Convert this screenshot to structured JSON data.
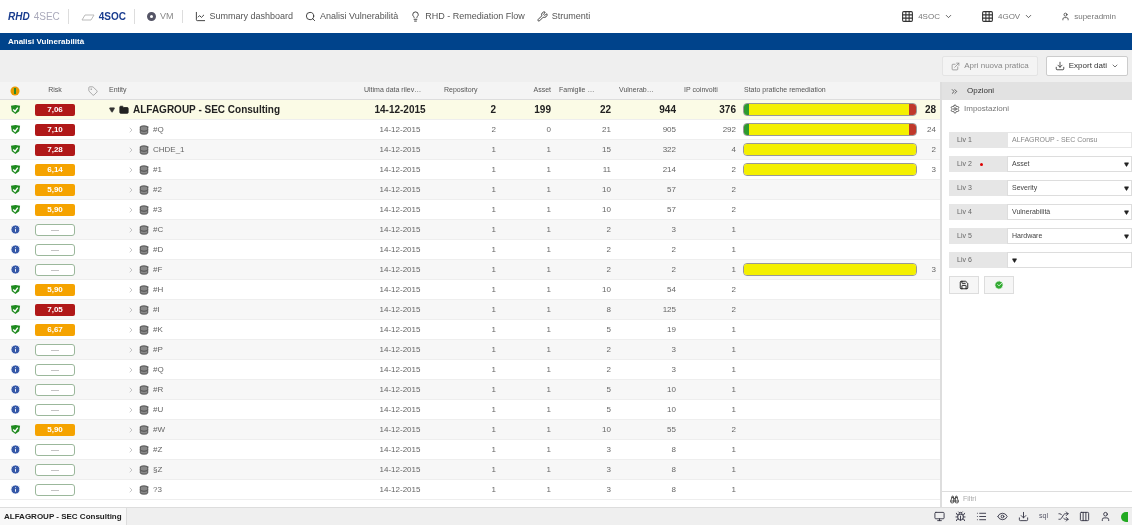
{
  "brand": {
    "logo": "RHD",
    "product": "4SEC",
    "modules": [
      {
        "kind": "soc",
        "label": "4SOC"
      },
      {
        "kind": "vm",
        "label": "VM"
      }
    ]
  },
  "nav": [
    {
      "kind": "chart",
      "label": "Summary dashboard"
    },
    {
      "kind": "search",
      "label": "Analisi Vulnerabilità"
    },
    {
      "kind": "bulb",
      "label": "RHD - Remediation Flow"
    },
    {
      "kind": "tools",
      "label": "Strumenti"
    }
  ],
  "nav_right": [
    {
      "kind": "grid",
      "label": "4SOC"
    },
    {
      "kind": "grid",
      "label": "4GOV"
    },
    {
      "kind": "user",
      "label": "superadmin"
    }
  ],
  "page_title": "Analisi Vulnerabilità",
  "toolbar": [
    {
      "kind": "new",
      "label": "Apri nuova pratica",
      "disabled": true
    },
    {
      "kind": "export",
      "label": "Export dati",
      "disabled": false
    }
  ],
  "table": {
    "columns": [
      "Risk",
      "Entity",
      "Ultima data rilev…",
      "Repository",
      "Asset",
      "Famiglie …",
      "Vulnerab…",
      "IP coinvolti",
      "Stato pratiche remediation"
    ],
    "rows": [
      {
        "selected": true,
        "status": {
          "kind": "ok"
        },
        "risk": {
          "kind": "score",
          "text": "7,06",
          "color": "#b01818"
        },
        "expanded": true,
        "kind": "group",
        "entity": "ALFAGROUP - SEC Consulting",
        "date": "14-12-2015",
        "repository": "2",
        "asset": "199",
        "famiglie": "22",
        "vulnerab": "944",
        "ip": "376",
        "remediation": [
          {
            "color": "#2f9a2f",
            "level": 0.03
          },
          {
            "color": "#f4f000",
            "level": 0.93
          },
          {
            "color": "#c0392b",
            "level": 0.04
          }
        ],
        "remediation_count": "28"
      },
      {
        "selected": false,
        "status": {
          "kind": "ok"
        },
        "risk": {
          "kind": "score",
          "text": "7,10",
          "color": "#b01818"
        },
        "expanded": false,
        "kind": "asset",
        "entity": "#Q",
        "date": "14-12-2015",
        "repository": "2",
        "asset": "0",
        "famiglie": "21",
        "vulnerab": "905",
        "ip": "292",
        "remediation": [
          {
            "color": "#2f9a2f",
            "level": 0.03
          },
          {
            "color": "#f4f000",
            "level": 0.93
          },
          {
            "color": "#c0392b",
            "level": 0.04
          }
        ],
        "remediation_count": "24"
      },
      {
        "selected": false,
        "status": {
          "kind": "ok"
        },
        "risk": {
          "kind": "score",
          "text": "7,28",
          "color": "#b01818"
        },
        "expanded": false,
        "kind": "asset",
        "entity": "CHDE_1",
        "date": "14-12-2015",
        "repository": "1",
        "asset": "1",
        "famiglie": "15",
        "vulnerab": "322",
        "ip": "4",
        "remediation": [
          {
            "color": "#f4f000",
            "level": 1
          }
        ],
        "remediation_count": "2"
      },
      {
        "selected": false,
        "status": {
          "kind": "ok"
        },
        "risk": {
          "kind": "score",
          "text": "6,14",
          "color": "#f5a300"
        },
        "expanded": false,
        "kind": "asset",
        "entity": "#1",
        "date": "14-12-2015",
        "repository": "1",
        "asset": "1",
        "famiglie": "11",
        "vulnerab": "214",
        "ip": "2",
        "remediation": [
          {
            "color": "#f4f000",
            "level": 1
          }
        ],
        "remediation_count": "3"
      },
      {
        "selected": false,
        "status": {
          "kind": "ok"
        },
        "risk": {
          "kind": "score",
          "text": "5,90",
          "color": "#f5a300"
        },
        "expanded": false,
        "kind": "asset",
        "entity": "#2",
        "date": "14-12-2015",
        "repository": "1",
        "asset": "1",
        "famiglie": "10",
        "vulnerab": "57",
        "ip": "2"
      },
      {
        "selected": false,
        "status": {
          "kind": "ok"
        },
        "risk": {
          "kind": "score",
          "text": "5,90",
          "color": "#f5a300"
        },
        "expanded": false,
        "kind": "asset",
        "entity": "#3",
        "date": "14-12-2015",
        "repository": "1",
        "asset": "1",
        "famiglie": "10",
        "vulnerab": "57",
        "ip": "2"
      },
      {
        "selected": false,
        "status": {
          "kind": "info"
        },
        "risk": {
          "kind": "none",
          "text": "—"
        },
        "expanded": false,
        "kind": "asset",
        "entity": "#C",
        "date": "14-12-2015",
        "repository": "1",
        "asset": "1",
        "famiglie": "2",
        "vulnerab": "3",
        "ip": "1"
      },
      {
        "selected": false,
        "status": {
          "kind": "info"
        },
        "risk": {
          "kind": "none",
          "text": "—"
        },
        "expanded": false,
        "kind": "asset",
        "entity": "#D",
        "date": "14-12-2015",
        "repository": "1",
        "asset": "1",
        "famiglie": "2",
        "vulnerab": "2",
        "ip": "1"
      },
      {
        "selected": false,
        "status": {
          "kind": "info"
        },
        "risk": {
          "kind": "none",
          "text": "—"
        },
        "expanded": false,
        "kind": "asset",
        "entity": "#F",
        "date": "14-12-2015",
        "repository": "1",
        "asset": "1",
        "famiglie": "2",
        "vulnerab": "2",
        "ip": "1",
        "remediation": [
          {
            "color": "#f4f000",
            "level": 1
          }
        ],
        "remediation_count": "3"
      },
      {
        "selected": false,
        "status": {
          "kind": "ok"
        },
        "risk": {
          "kind": "score",
          "text": "5,90",
          "color": "#f5a300"
        },
        "expanded": false,
        "kind": "asset",
        "entity": "#H",
        "date": "14-12-2015",
        "repository": "1",
        "asset": "1",
        "famiglie": "10",
        "vulnerab": "54",
        "ip": "2"
      },
      {
        "selected": false,
        "status": {
          "kind": "ok"
        },
        "risk": {
          "kind": "score",
          "text": "7,05",
          "color": "#b01818"
        },
        "expanded": false,
        "kind": "asset",
        "entity": "#I",
        "date": "14-12-2015",
        "repository": "1",
        "asset": "1",
        "famiglie": "8",
        "vulnerab": "125",
        "ip": "2"
      },
      {
        "selected": false,
        "status": {
          "kind": "ok"
        },
        "risk": {
          "kind": "score",
          "text": "6,67",
          "color": "#f5a300"
        },
        "expanded": false,
        "kind": "asset",
        "entity": "#K",
        "date": "14-12-2015",
        "repository": "1",
        "asset": "1",
        "famiglie": "5",
        "vulnerab": "19",
        "ip": "1"
      },
      {
        "selected": false,
        "status": {
          "kind": "info"
        },
        "risk": {
          "kind": "none",
          "text": "—"
        },
        "expanded": false,
        "kind": "asset",
        "entity": "#P",
        "date": "14-12-2015",
        "repository": "1",
        "asset": "1",
        "famiglie": "2",
        "vulnerab": "3",
        "ip": "1"
      },
      {
        "selected": false,
        "status": {
          "kind": "info"
        },
        "risk": {
          "kind": "none",
          "text": "—"
        },
        "expanded": false,
        "kind": "asset",
        "entity": "#Q",
        "date": "14-12-2015",
        "repository": "1",
        "asset": "1",
        "famiglie": "2",
        "vulnerab": "3",
        "ip": "1"
      },
      {
        "selected": false,
        "status": {
          "kind": "info"
        },
        "risk": {
          "kind": "none",
          "text": "—"
        },
        "expanded": false,
        "kind": "asset",
        "entity": "#R",
        "date": "14-12-2015",
        "repository": "1",
        "asset": "1",
        "famiglie": "5",
        "vulnerab": "10",
        "ip": "1"
      },
      {
        "selected": false,
        "status": {
          "kind": "info"
        },
        "risk": {
          "kind": "none",
          "text": "—"
        },
        "expanded": false,
        "kind": "asset",
        "entity": "#U",
        "date": "14-12-2015",
        "repository": "1",
        "asset": "1",
        "famiglie": "5",
        "vulnerab": "10",
        "ip": "1"
      },
      {
        "selected": false,
        "status": {
          "kind": "ok"
        },
        "risk": {
          "kind": "score",
          "text": "5,90",
          "color": "#f5a300"
        },
        "expanded": false,
        "kind": "asset",
        "entity": "#W",
        "date": "14-12-2015",
        "repository": "1",
        "asset": "1",
        "famiglie": "10",
        "vulnerab": "55",
        "ip": "2"
      },
      {
        "selected": false,
        "status": {
          "kind": "info"
        },
        "risk": {
          "kind": "none",
          "text": "—"
        },
        "expanded": false,
        "kind": "asset",
        "entity": "#Z",
        "date": "14-12-2015",
        "repository": "1",
        "asset": "1",
        "famiglie": "3",
        "vulnerab": "8",
        "ip": "1"
      },
      {
        "selected": false,
        "status": {
          "kind": "info"
        },
        "risk": {
          "kind": "none",
          "text": "—"
        },
        "expanded": false,
        "kind": "asset",
        "entity": "§Z",
        "date": "14-12-2015",
        "repository": "1",
        "asset": "1",
        "famiglie": "3",
        "vulnerab": "8",
        "ip": "1"
      },
      {
        "selected": false,
        "status": {
          "kind": "info"
        },
        "risk": {
          "kind": "none",
          "text": "—"
        },
        "expanded": false,
        "kind": "asset",
        "entity": "?3",
        "date": "14-12-2015",
        "repository": "1",
        "asset": "1",
        "famiglie": "3",
        "vulnerab": "8",
        "ip": "1"
      }
    ]
  },
  "panel": {
    "title": "Opzioni",
    "section": "Impostazioni",
    "levels": [
      {
        "label": "Liv 1",
        "kind": "text",
        "value": "ALFAGROUP - SEC Consu",
        "required": false
      },
      {
        "label": "Liv 2",
        "kind": "select",
        "value": "Asset",
        "required": true
      },
      {
        "label": "Liv 3",
        "kind": "select",
        "value": "Severity",
        "required": false
      },
      {
        "label": "Liv 4",
        "kind": "select",
        "value": "Vulnerabilità",
        "required": false
      },
      {
        "label": "Liv 5",
        "kind": "select",
        "value": "Hardware",
        "required": false
      },
      {
        "label": "Liv 6",
        "kind": "select",
        "required": false
      }
    ],
    "filter": "Filtri"
  },
  "footer": {
    "tab": "ALFAGROUP - SEC Consulting",
    "tools": [
      {
        "kind": "monitor"
      },
      {
        "kind": "bug"
      },
      {
        "kind": "list"
      },
      {
        "kind": "eye"
      },
      {
        "kind": "download"
      },
      {
        "kind": "text",
        "label": "sql"
      },
      {
        "kind": "shuffle"
      },
      {
        "kind": "columns"
      },
      {
        "kind": "user"
      },
      {
        "kind": "status"
      }
    ]
  }
}
